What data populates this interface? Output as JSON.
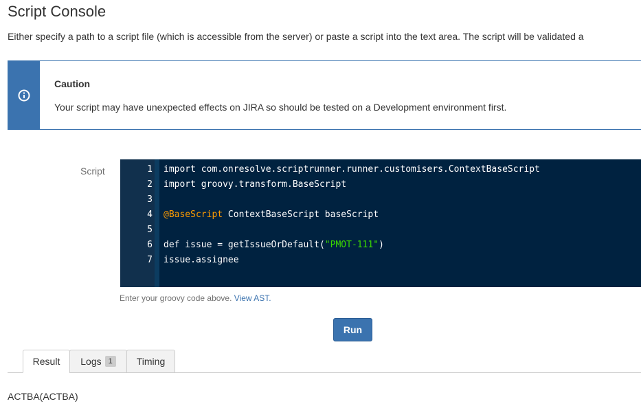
{
  "page": {
    "title": "Script Console",
    "description": "Either specify a path to a script file (which is accessible from the server) or paste a script into the text area. The script will be validated a"
  },
  "caution": {
    "icon": "info-icon",
    "title": "Caution",
    "text": "Your script may have unexpected effects on JIRA so should be tested on a Development environment first."
  },
  "editor": {
    "label": "Script",
    "lines": [
      {
        "num": "1",
        "text": "import com.onresolve.scriptrunner.runner.customisers.ContextBaseScript"
      },
      {
        "num": "2",
        "text": "import groovy.transform.BaseScript"
      },
      {
        "num": "3",
        "text": ""
      },
      {
        "num": "4",
        "annotation": "@BaseScript",
        "text": " ContextBaseScript baseScript"
      },
      {
        "num": "5",
        "text": ""
      },
      {
        "num": "6",
        "before": "def issue = getIssueOrDefault(",
        "string": "\"PMOT-111\"",
        "after": ")"
      },
      {
        "num": "7",
        "text": "issue.assignee"
      }
    ],
    "hint": "Enter your groovy code above.",
    "hint_link": "View AST."
  },
  "run_button": "Run",
  "tabs": [
    {
      "label": "Result",
      "active": true
    },
    {
      "label": "Logs",
      "badge": "1"
    },
    {
      "label": "Timing"
    }
  ],
  "result": "ACTBA(ACTBA)",
  "colors": {
    "accent": "#3b73af",
    "editor_bg": "#002240",
    "annotation": "#ff9d00",
    "string": "#3ad900"
  }
}
